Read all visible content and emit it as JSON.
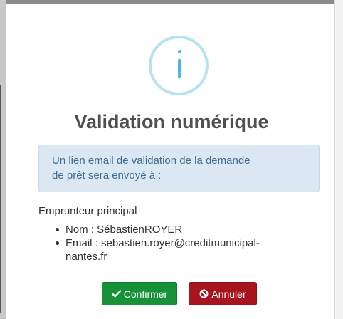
{
  "dialog": {
    "icon": "info-icon",
    "title": "Validation numérique",
    "alert": {
      "line1": "Un lien email de validation de la demande",
      "line2": "de prêt sera envoyé à :"
    },
    "section_heading": "Emprunteur principal",
    "details": {
      "nom": "Nom : SébastienROYER",
      "email_line1": "Email : sebastien.royer@creditmunicipal-",
      "email_line2": "nantes.fr"
    },
    "buttons": {
      "confirm": {
        "label": "Confirmer",
        "icon": "check-icon",
        "color": "#169136"
      },
      "cancel": {
        "label": "Annuler",
        "icon": "ban-icon",
        "color": "#a8141d"
      }
    }
  },
  "colors": {
    "info_ring": "#b5e3f2",
    "info_glyph": "#4fb6dc",
    "alert_bg": "#dbe8f3",
    "alert_text": "#3f6c93"
  }
}
